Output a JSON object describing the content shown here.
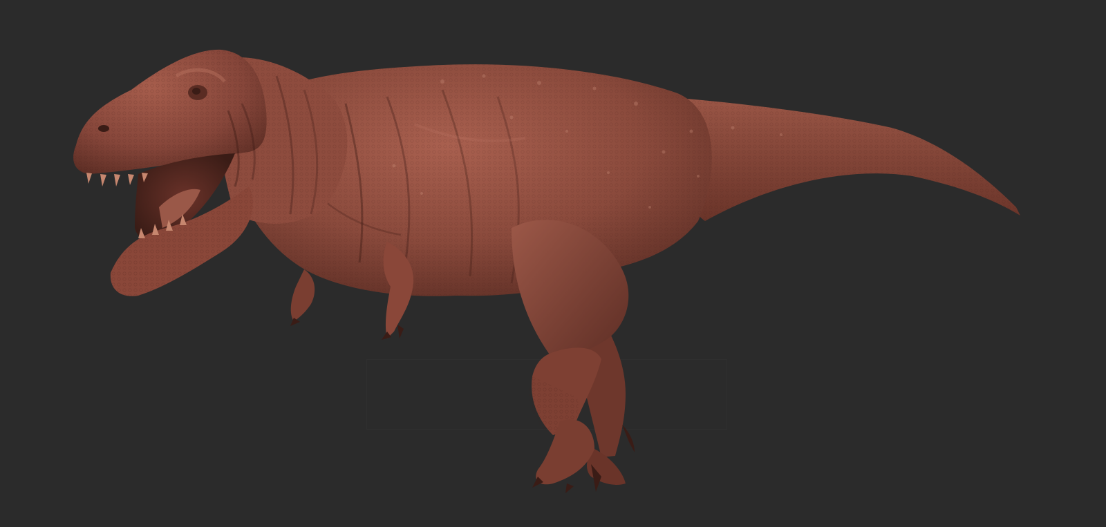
{
  "scene": {
    "subject": "tyrannosaurus-rex-clay-sculpt",
    "background_color": "#2b2b2b",
    "clay_base_color": "#8a4a3c",
    "clay_light_color": "#a9604f",
    "clay_shadow_color": "#5a2c23",
    "clay_dark_color": "#3a1c16"
  }
}
